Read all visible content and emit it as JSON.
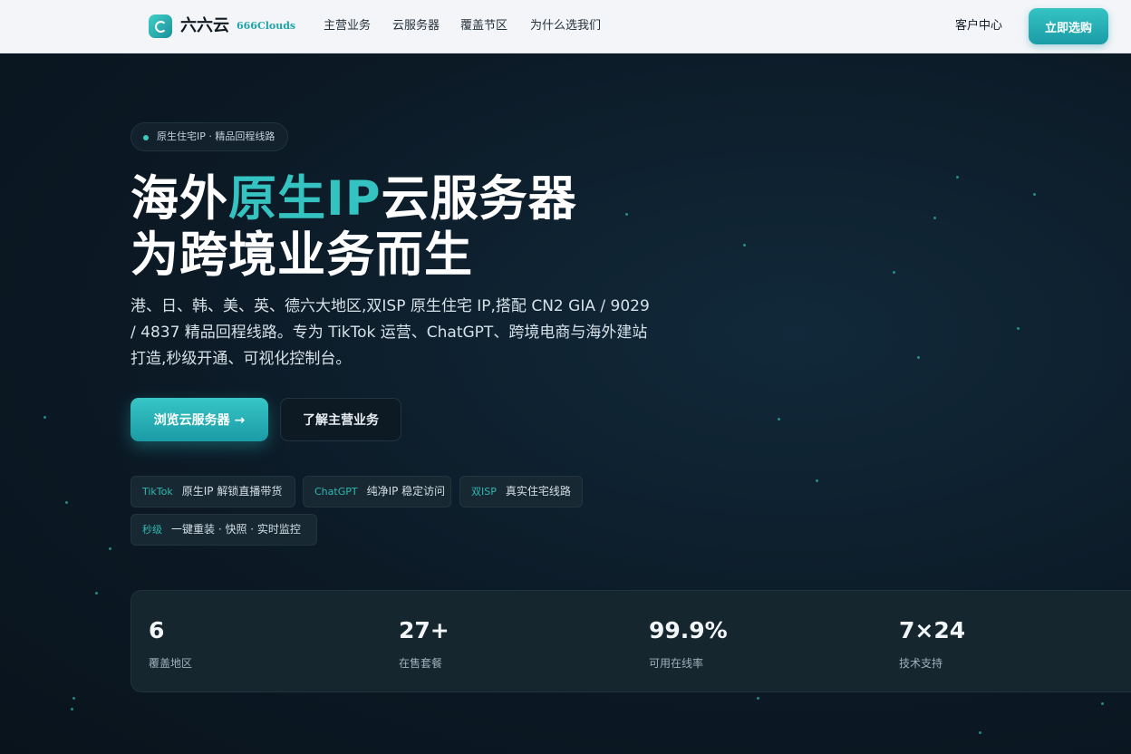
{
  "header": {
    "logo_cn": "六六云",
    "logo_en": "666Clouds",
    "nav": [
      "主营业务",
      "云服务器",
      "覆盖节区",
      "为什么选我们"
    ],
    "client_center": "客户中心",
    "buy_button": "立即选购"
  },
  "hero": {
    "tag": "原生住宅IP · 精品回程线路",
    "title_line1_pre": "海外",
    "title_line1_accent": "原生IP",
    "title_line1_post": "云服务器",
    "title_line2": "为跨境业务而生",
    "description": "港、日、韩、美、英、德六大地区,双ISP 原生住宅 IP,搭配 CN2 GIA / 9029 / 4837 精品回程线路。专为 TikTok 运营、ChatGPT、跨境电商与海外建站打造,秒级开通、可视化控制台。",
    "primary_cta": "浏览云服务器 →",
    "secondary_cta": "了解主营业务",
    "chips": [
      {
        "key": "TikTok",
        "text": "原生IP 解锁直播带货"
      },
      {
        "key": "ChatGPT",
        "text": "纯净IP 稳定访问"
      },
      {
        "key": "双ISP",
        "text": "真实住宅线路"
      },
      {
        "key": "秒级",
        "text": "一键重装 · 快照 · 实时监控"
      }
    ]
  },
  "stats": [
    {
      "value": "6",
      "label": "覆盖地区"
    },
    {
      "value": "27+",
      "label": "在售套餐"
    },
    {
      "value": "99.9%",
      "label": "可用在线率"
    },
    {
      "value": "7×24",
      "label": "技术支持"
    }
  ],
  "colors": {
    "accent": "#35c3c2",
    "background": "#0b1620",
    "header_bg": "#f3f5f8"
  }
}
